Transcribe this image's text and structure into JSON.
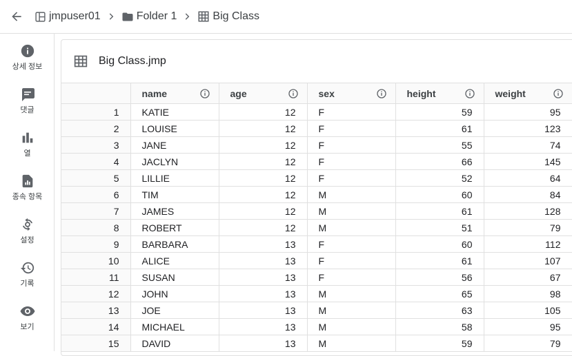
{
  "breadcrumb": {
    "items": [
      {
        "label": "jmpuser01",
        "icon": "space-grid-icon"
      },
      {
        "label": "Folder 1",
        "icon": "folder-icon"
      },
      {
        "label": "Big Class",
        "icon": "table-icon"
      }
    ]
  },
  "sidebar": {
    "items": [
      {
        "label": "상세 정보",
        "icon": "info-icon"
      },
      {
        "label": "댓글",
        "icon": "comment-icon"
      },
      {
        "label": "열",
        "icon": "bar-chart-icon"
      },
      {
        "label": "종속 항목",
        "icon": "dependency-file-icon"
      },
      {
        "label": "설정",
        "icon": "settings-sync-icon"
      },
      {
        "label": "기록",
        "icon": "history-icon"
      },
      {
        "label": "보기",
        "icon": "eye-icon"
      }
    ]
  },
  "panel": {
    "title": "Big Class.jmp",
    "icon": "table-grid-icon"
  },
  "table": {
    "columns": [
      "name",
      "age",
      "sex",
      "height",
      "weight"
    ],
    "rows": [
      [
        "1",
        "KATIE",
        "12",
        "F",
        "59",
        "95"
      ],
      [
        "2",
        "LOUISE",
        "12",
        "F",
        "61",
        "123"
      ],
      [
        "3",
        "JANE",
        "12",
        "F",
        "55",
        "74"
      ],
      [
        "4",
        "JACLYN",
        "12",
        "F",
        "66",
        "145"
      ],
      [
        "5",
        "LILLIE",
        "12",
        "F",
        "52",
        "64"
      ],
      [
        "6",
        "TIM",
        "12",
        "M",
        "60",
        "84"
      ],
      [
        "7",
        "JAMES",
        "12",
        "M",
        "61",
        "128"
      ],
      [
        "8",
        "ROBERT",
        "12",
        "M",
        "51",
        "79"
      ],
      [
        "9",
        "BARBARA",
        "13",
        "F",
        "60",
        "112"
      ],
      [
        "10",
        "ALICE",
        "13",
        "F",
        "61",
        "107"
      ],
      [
        "11",
        "SUSAN",
        "13",
        "F",
        "56",
        "67"
      ],
      [
        "12",
        "JOHN",
        "13",
        "M",
        "65",
        "98"
      ],
      [
        "13",
        "JOE",
        "13",
        "M",
        "63",
        "105"
      ],
      [
        "14",
        "MICHAEL",
        "13",
        "M",
        "58",
        "95"
      ],
      [
        "15",
        "DAVID",
        "13",
        "M",
        "59",
        "79"
      ]
    ]
  },
  "colors": {
    "icon": "#5f6368",
    "border": "#e0e0e0",
    "text": "#202124"
  }
}
